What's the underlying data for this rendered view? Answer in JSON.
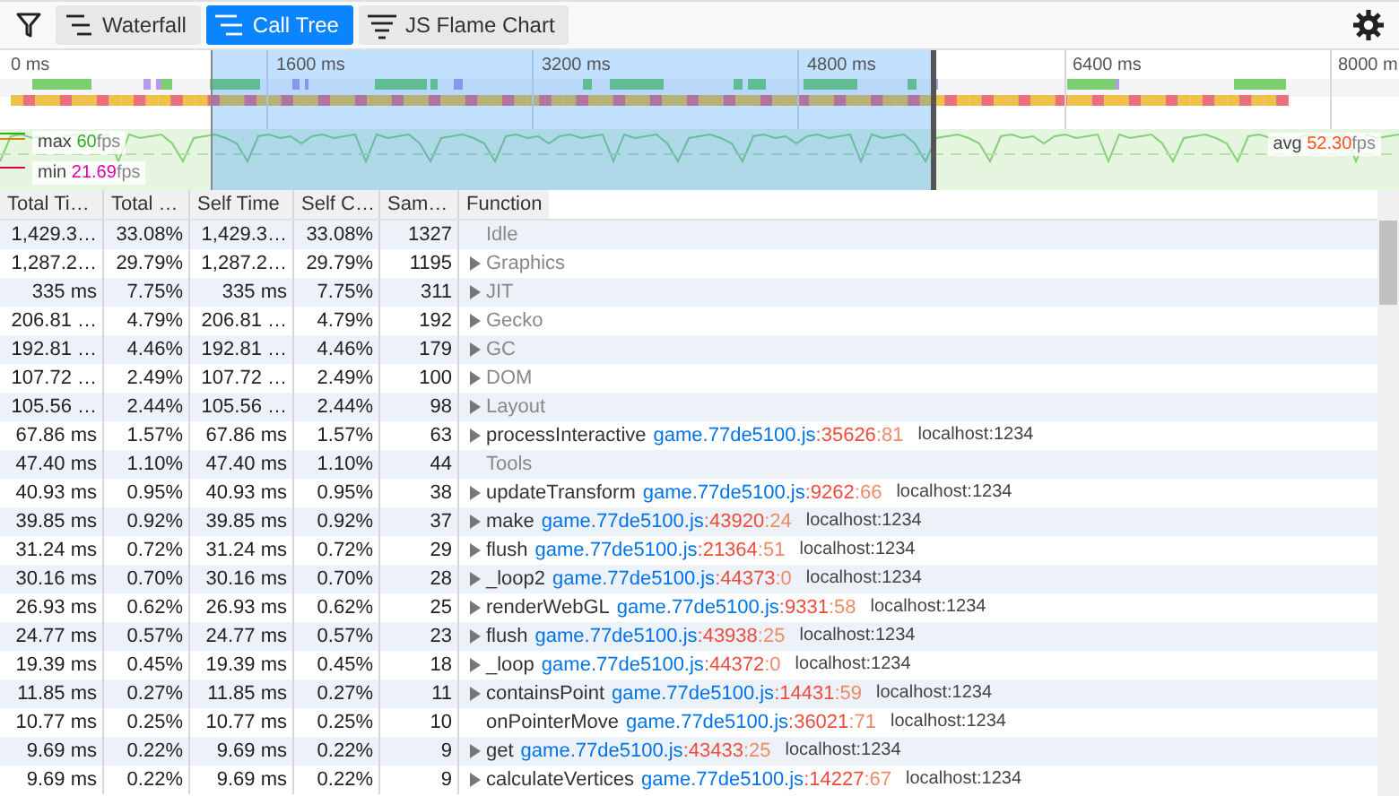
{
  "toolbar": {
    "tabs": [
      {
        "label": "Waterfall",
        "selected": false,
        "kind": "waterfall"
      },
      {
        "label": "Call Tree",
        "selected": true,
        "kind": "tree"
      },
      {
        "label": "JS Flame Chart",
        "selected": false,
        "kind": "flame"
      }
    ]
  },
  "overview": {
    "ticks": [
      "0 ms",
      "1600 ms",
      "3200 ms",
      "4800 ms",
      "6400 ms",
      "8000 m"
    ],
    "fps": [
      {
        "kind": "max",
        "label": "max",
        "value": "60",
        "unit": "fps"
      },
      {
        "kind": "min",
        "label": "min",
        "value": "21.69",
        "unit": "fps"
      },
      {
        "kind": "avg",
        "label": "avg",
        "value": "52.30",
        "unit": "fps"
      }
    ]
  },
  "table": {
    "columns": [
      "Total Ti…",
      "Total …",
      "Self Time",
      "Self C…",
      "Sam…",
      "Function"
    ],
    "rows": [
      {
        "total_time": "1,429.3…",
        "total_pct": "33.08%",
        "self_time": "1,429.3…",
        "self_pct": "33.08%",
        "samples": "1327",
        "name": "Idle",
        "kind": "category",
        "expandable": false
      },
      {
        "total_time": "1,287.2…",
        "total_pct": "29.79%",
        "self_time": "1,287.2…",
        "self_pct": "29.79%",
        "samples": "1195",
        "name": "Graphics",
        "kind": "category",
        "expandable": true
      },
      {
        "total_time": "335 ms",
        "total_pct": "7.75%",
        "self_time": "335 ms",
        "self_pct": "7.75%",
        "samples": "311",
        "name": "JIT",
        "kind": "category",
        "expandable": true
      },
      {
        "total_time": "206.81 …",
        "total_pct": "4.79%",
        "self_time": "206.81 …",
        "self_pct": "4.79%",
        "samples": "192",
        "name": "Gecko",
        "kind": "category",
        "expandable": true
      },
      {
        "total_time": "192.81 …",
        "total_pct": "4.46%",
        "self_time": "192.81 …",
        "self_pct": "4.46%",
        "samples": "179",
        "name": "GC",
        "kind": "category",
        "expandable": true
      },
      {
        "total_time": "107.72 …",
        "total_pct": "2.49%",
        "self_time": "107.72 …",
        "self_pct": "2.49%",
        "samples": "100",
        "name": "DOM",
        "kind": "category",
        "expandable": true
      },
      {
        "total_time": "105.56 …",
        "total_pct": "2.44%",
        "self_time": "105.56 …",
        "self_pct": "2.44%",
        "samples": "98",
        "name": "Layout",
        "kind": "category",
        "expandable": true
      },
      {
        "total_time": "67.86 ms",
        "total_pct": "1.57%",
        "self_time": "67.86 ms",
        "self_pct": "1.57%",
        "samples": "63",
        "name": "processInteractive",
        "kind": "js",
        "expandable": true,
        "file": "game.77de5100.js",
        "line": ":35626",
        "column": ":81",
        "host": "localhost:1234"
      },
      {
        "total_time": "47.40 ms",
        "total_pct": "1.10%",
        "self_time": "47.40 ms",
        "self_pct": "1.10%",
        "samples": "44",
        "name": "Tools",
        "kind": "category",
        "expandable": false
      },
      {
        "total_time": "40.93 ms",
        "total_pct": "0.95%",
        "self_time": "40.93 ms",
        "self_pct": "0.95%",
        "samples": "38",
        "name": "updateTransform",
        "kind": "js",
        "expandable": true,
        "file": "game.77de5100.js",
        "line": ":9262",
        "column": ":66",
        "host": "localhost:1234"
      },
      {
        "total_time": "39.85 ms",
        "total_pct": "0.92%",
        "self_time": "39.85 ms",
        "self_pct": "0.92%",
        "samples": "37",
        "name": "make",
        "kind": "js",
        "expandable": true,
        "file": "game.77de5100.js",
        "line": ":43920",
        "column": ":24",
        "host": "localhost:1234"
      },
      {
        "total_time": "31.24 ms",
        "total_pct": "0.72%",
        "self_time": "31.24 ms",
        "self_pct": "0.72%",
        "samples": "29",
        "name": "flush",
        "kind": "js",
        "expandable": true,
        "file": "game.77de5100.js",
        "line": ":21364",
        "column": ":51",
        "host": "localhost:1234"
      },
      {
        "total_time": "30.16 ms",
        "total_pct": "0.70%",
        "self_time": "30.16 ms",
        "self_pct": "0.70%",
        "samples": "28",
        "name": "_loop2",
        "kind": "js",
        "expandable": true,
        "file": "game.77de5100.js",
        "line": ":44373",
        "column": ":0",
        "host": "localhost:1234"
      },
      {
        "total_time": "26.93 ms",
        "total_pct": "0.62%",
        "self_time": "26.93 ms",
        "self_pct": "0.62%",
        "samples": "25",
        "name": "renderWebGL",
        "kind": "js",
        "expandable": true,
        "file": "game.77de5100.js",
        "line": ":9331",
        "column": ":58",
        "host": "localhost:1234"
      },
      {
        "total_time": "24.77 ms",
        "total_pct": "0.57%",
        "self_time": "24.77 ms",
        "self_pct": "0.57%",
        "samples": "23",
        "name": "flush",
        "kind": "js",
        "expandable": true,
        "file": "game.77de5100.js",
        "line": ":43938",
        "column": ":25",
        "host": "localhost:1234"
      },
      {
        "total_time": "19.39 ms",
        "total_pct": "0.45%",
        "self_time": "19.39 ms",
        "self_pct": "0.45%",
        "samples": "18",
        "name": "_loop",
        "kind": "js",
        "expandable": true,
        "file": "game.77de5100.js",
        "line": ":44372",
        "column": ":0",
        "host": "localhost:1234"
      },
      {
        "total_time": "11.85 ms",
        "total_pct": "0.27%",
        "self_time": "11.85 ms",
        "self_pct": "0.27%",
        "samples": "11",
        "name": "containsPoint",
        "kind": "js",
        "expandable": true,
        "file": "game.77de5100.js",
        "line": ":14431",
        "column": ":59",
        "host": "localhost:1234"
      },
      {
        "total_time": "10.77 ms",
        "total_pct": "0.25%",
        "self_time": "10.77 ms",
        "self_pct": "0.25%",
        "samples": "10",
        "name": "onPointerMove",
        "kind": "js",
        "expandable": false,
        "file": "game.77de5100.js",
        "line": ":36021",
        "column": ":71",
        "host": "localhost:1234"
      },
      {
        "total_time": "9.69 ms",
        "total_pct": "0.22%",
        "self_time": "9.69 ms",
        "self_pct": "0.22%",
        "samples": "9",
        "name": "get",
        "kind": "js",
        "expandable": true,
        "file": "game.77de5100.js",
        "line": ":43433",
        "column": ":25",
        "host": "localhost:1234"
      },
      {
        "total_time": "9.69 ms",
        "total_pct": "0.22%",
        "self_time": "9.69 ms",
        "self_pct": "0.22%",
        "samples": "9",
        "name": "calculateVertices",
        "kind": "js",
        "expandable": true,
        "file": "game.77de5100.js",
        "line": ":14227",
        "column": ":67",
        "host": "localhost:1234"
      }
    ]
  }
}
